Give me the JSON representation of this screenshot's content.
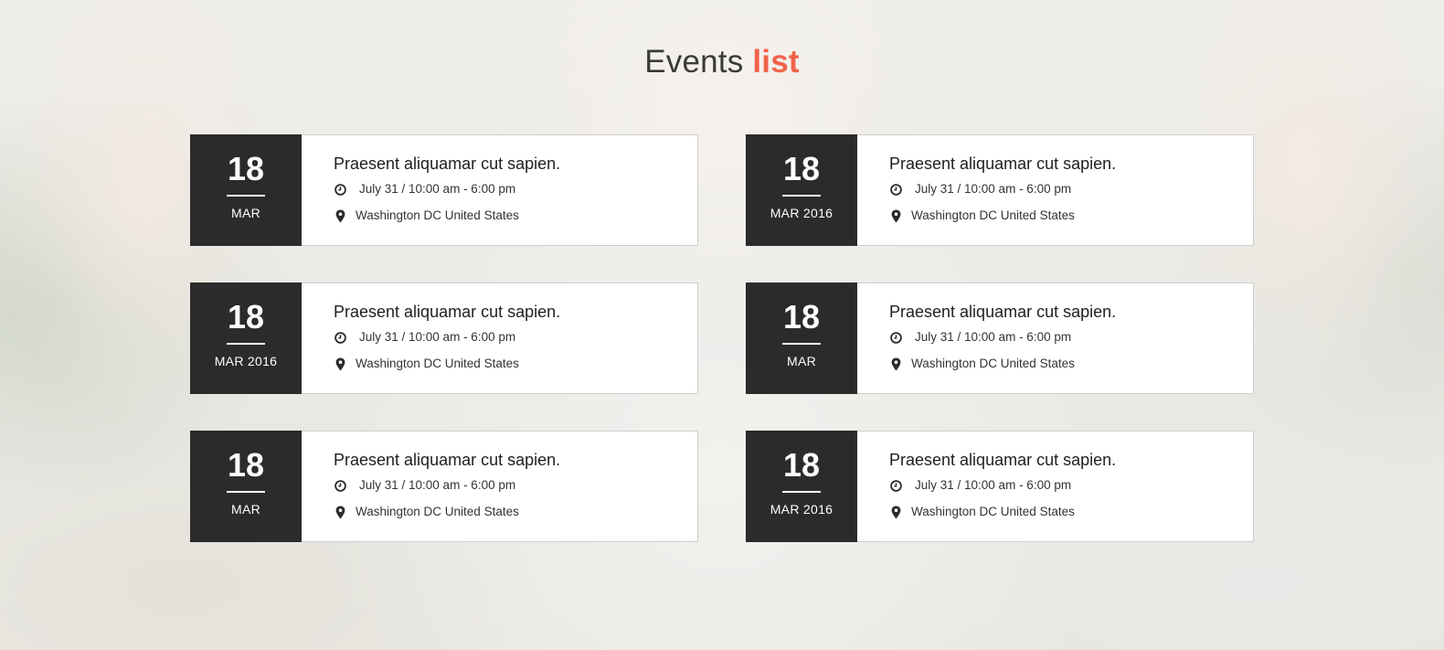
{
  "heading": {
    "main": "Events",
    "accent": "list"
  },
  "colors": {
    "accent": "#f1624a",
    "date_box": "#2b2b2b"
  },
  "events": [
    {
      "day": "18",
      "month": "MAR",
      "title": "Praesent aliquamar cut sapien.",
      "time": "July 31 / 10:00 am - 6:00 pm",
      "location": "Washington DC United States",
      "time_icon": "clock-icon",
      "location_icon": "map-pin-icon"
    },
    {
      "day": "18",
      "month": "MAR 2016",
      "title": "Praesent aliquamar cut sapien.",
      "time": "July 31 / 10:00 am - 6:00 pm",
      "location": "Washington DC United States",
      "time_icon": "clock-icon",
      "location_icon": "map-pin-icon"
    },
    {
      "day": "18",
      "month": "MAR 2016",
      "title": "Praesent aliquamar cut sapien.",
      "time": "July 31 / 10:00 am - 6:00 pm",
      "location": "Washington DC United States",
      "time_icon": "clock-icon",
      "location_icon": "map-pin-icon"
    },
    {
      "day": "18",
      "month": "MAR",
      "title": "Praesent aliquamar cut sapien.",
      "time": "July 31 / 10:00 am - 6:00 pm",
      "location": "Washington DC United States",
      "time_icon": "clock-icon",
      "location_icon": "map-pin-icon"
    },
    {
      "day": "18",
      "month": "MAR",
      "title": "Praesent aliquamar cut sapien.",
      "time": "July 31 / 10:00 am - 6:00 pm",
      "location": "Washington DC United States",
      "time_icon": "clock-icon",
      "location_icon": "map-pin-icon"
    },
    {
      "day": "18",
      "month": "MAR 2016",
      "title": "Praesent aliquamar cut sapien.",
      "time": "July 31 / 10:00 am - 6:00 pm",
      "location": "Washington DC United States",
      "time_icon": "clock-icon",
      "location_icon": "map-pin-icon"
    }
  ]
}
